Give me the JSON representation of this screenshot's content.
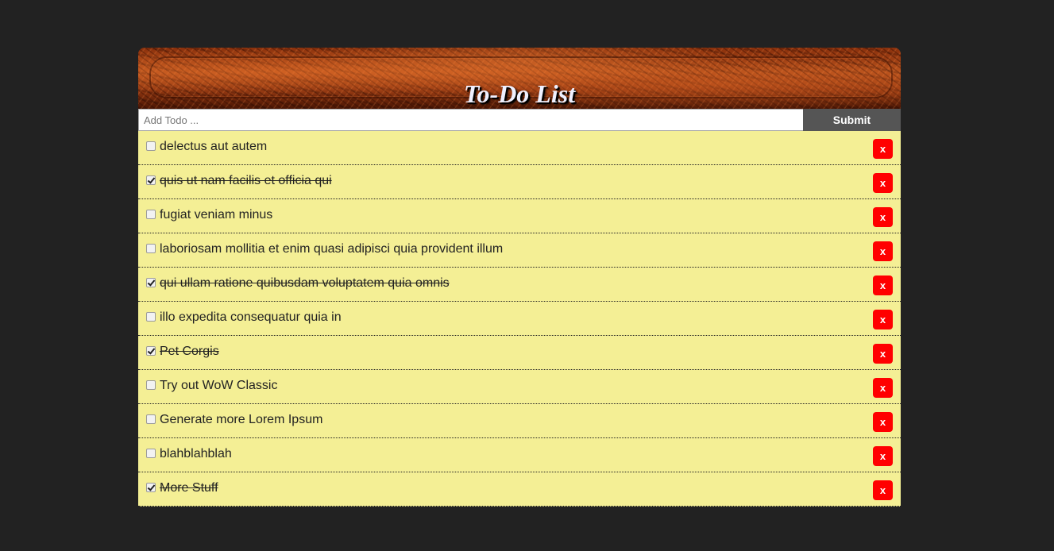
{
  "header": {
    "title": "To-Do List"
  },
  "form": {
    "placeholder": "Add Todo ...",
    "submit_label": "Submit"
  },
  "todos": [
    {
      "title": "delectus aut autem",
      "completed": false,
      "delete_label": "x"
    },
    {
      "title": "quis ut nam facilis et officia qui",
      "completed": true,
      "delete_label": "x"
    },
    {
      "title": "fugiat veniam minus",
      "completed": false,
      "delete_label": "x"
    },
    {
      "title": "laboriosam mollitia et enim quasi adipisci quia provident illum",
      "completed": false,
      "delete_label": "x"
    },
    {
      "title": "qui ullam ratione quibusdam voluptatem quia omnis",
      "completed": true,
      "delete_label": "x"
    },
    {
      "title": "illo expedita consequatur quia in",
      "completed": false,
      "delete_label": "x"
    },
    {
      "title": "Pet Corgis",
      "completed": true,
      "delete_label": "x"
    },
    {
      "title": "Try out WoW Classic",
      "completed": false,
      "delete_label": "x"
    },
    {
      "title": "Generate more Lorem Ipsum",
      "completed": false,
      "delete_label": "x"
    },
    {
      "title": "blahblahblah",
      "completed": false,
      "delete_label": "x"
    },
    {
      "title": "More Stuff",
      "completed": true,
      "delete_label": "x"
    }
  ],
  "colors": {
    "page_background": "#222222",
    "item_background": "#f4ef95",
    "delete_button": "#ff0000",
    "submit_button": "#555555"
  }
}
